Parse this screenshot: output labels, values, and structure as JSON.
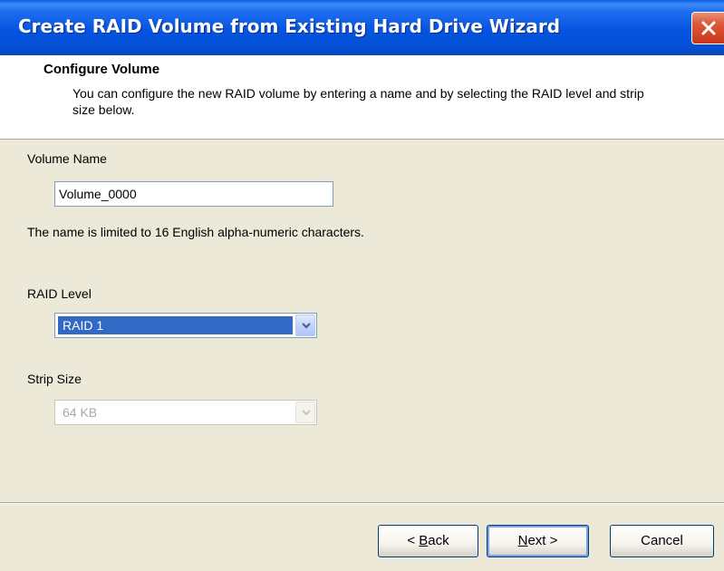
{
  "window": {
    "title": "Create RAID Volume from Existing Hard Drive Wizard",
    "close_icon": "close-icon"
  },
  "header": {
    "title": "Configure Volume",
    "description": "You can configure the new RAID volume by entering a name and by selecting the RAID level and strip size below."
  },
  "volume_name": {
    "label": "Volume Name",
    "value": "Volume_0000",
    "hint": "The name is limited to 16 English alpha-numeric characters."
  },
  "raid_level": {
    "label": "RAID Level",
    "selected": "RAID 1"
  },
  "strip_size": {
    "label": "Strip Size",
    "selected": "64 KB"
  },
  "buttons": {
    "back_prefix": "< ",
    "back_mnemonic": "B",
    "back_rest": "ack",
    "next_mnemonic": "N",
    "next_rest": "ext >",
    "cancel": "Cancel"
  },
  "colors": {
    "titlebar": "#0454e0",
    "selection": "#316ac5",
    "close": "#c8351a",
    "background": "#ece9d8"
  }
}
